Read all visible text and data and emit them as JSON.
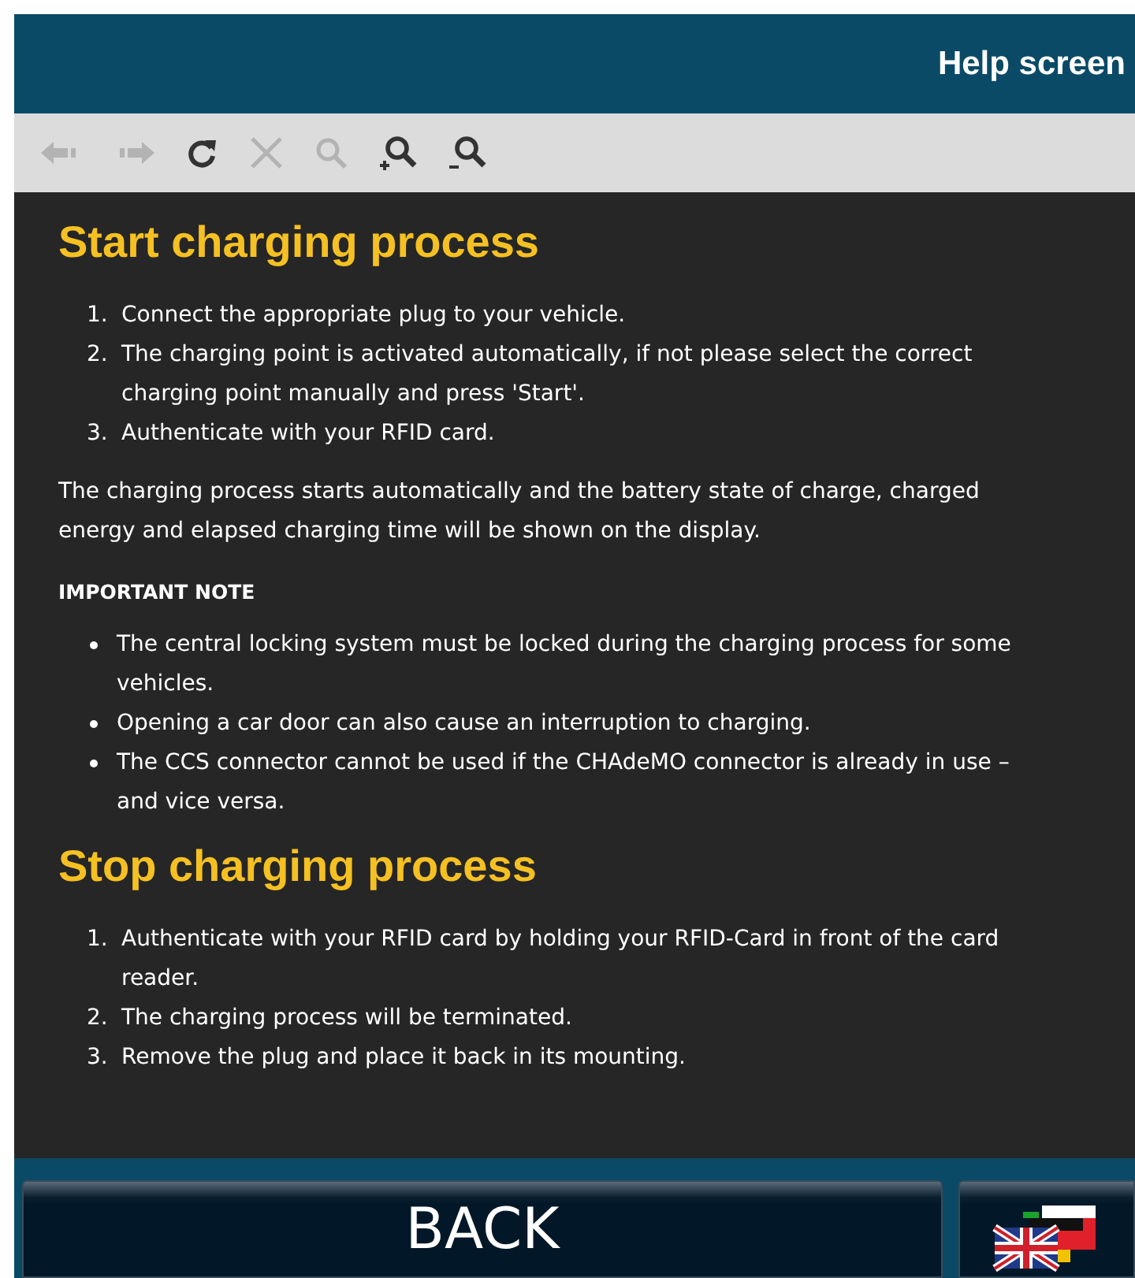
{
  "header": {
    "title": "Help screen"
  },
  "toolbar": [
    {
      "kind": "back",
      "disabled": true
    },
    {
      "kind": "forward",
      "disabled": true
    },
    {
      "kind": "refresh",
      "disabled": false
    },
    {
      "kind": "stop",
      "disabled": true
    },
    {
      "kind": "search",
      "disabled": true
    },
    {
      "kind": "zoom-in",
      "disabled": false
    },
    {
      "kind": "zoom-out",
      "disabled": false
    }
  ],
  "content": [
    {
      "kind": "heading",
      "text": "Start charging process"
    },
    {
      "kind": "ordered",
      "items": [
        {
          "number": "1.",
          "text": "Connect the appropriate plug to your vehicle."
        },
        {
          "number": "2.",
          "text": "The charging point is activated automatically, if not please select the correct charging point manually and press 'Start'."
        },
        {
          "number": "3.",
          "text": "Authenticate with your RFID card."
        }
      ]
    },
    {
      "kind": "paragraph",
      "text": "The charging process starts automatically and the battery state of charge, charged energy and elapsed charging time will be shown on the display."
    },
    {
      "kind": "note",
      "text": "IMPORTANT NOTE"
    },
    {
      "kind": "bullets",
      "items": [
        "The central locking system must be locked during the charging process for some vehicles.",
        "Opening a car door can also cause an interruption to charging.",
        "The CCS connector cannot be used if the CHAdeMO connector is already in use – and vice versa."
      ]
    },
    {
      "kind": "heading",
      "text": "Stop charging process"
    },
    {
      "kind": "ordered",
      "items": [
        {
          "number": "1.",
          "text": "Authenticate with your RFID card by holding your RFID-Card in front of the card reader."
        },
        {
          "number": "2.",
          "text": "The charging process will be terminated."
        },
        {
          "number": "3.",
          "text": "Remove the plug and place it back in its mounting."
        }
      ]
    }
  ],
  "footer": {
    "back_button": "BACK"
  }
}
